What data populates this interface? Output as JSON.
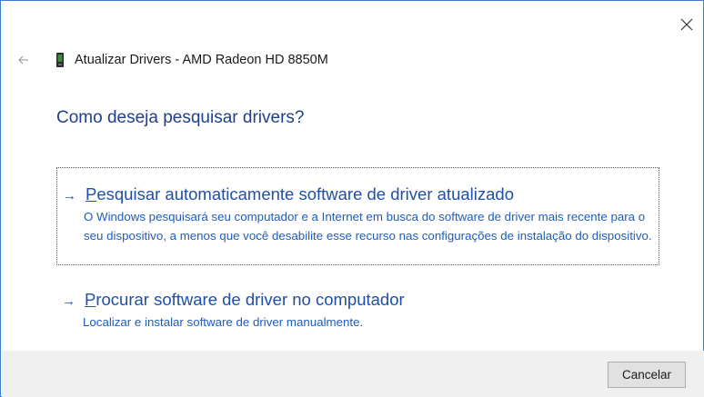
{
  "window": {
    "title": "Atualizar Drivers - AMD Radeon HD 8850M",
    "accent_color": "#3b7fd1",
    "icons": {
      "close": "close-icon",
      "back": "back-arrow-icon",
      "device": "display-adapter-icon"
    }
  },
  "main": {
    "heading": "Como deseja pesquisar drivers?",
    "options": [
      {
        "arrow": "→",
        "label_first": "P",
        "label_rest": "esquisar automaticamente software de driver atualizado",
        "description": "O Windows pesquisará seu computador e a Internet em busca do software de driver mais recente para o seu dispositivo, a menos que você desabilite esse recurso nas configurações de instalação do dispositivo."
      },
      {
        "arrow": "→",
        "label_first": "P",
        "label_rest": "rocurar software de driver no computador",
        "description": "Localizar e instalar software de driver manualmente."
      }
    ]
  },
  "footer": {
    "cancel_label": "Cancelar"
  }
}
